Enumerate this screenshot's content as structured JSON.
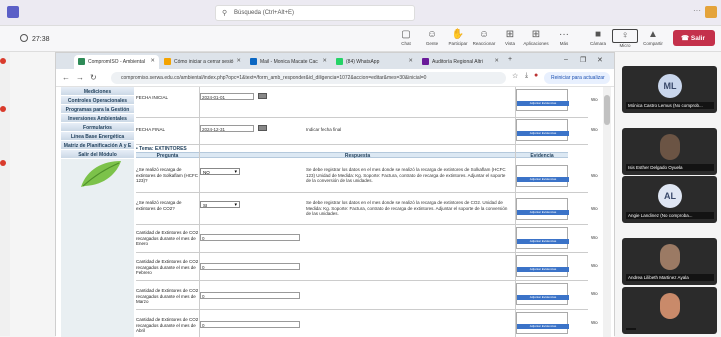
{
  "teams": {
    "search_placeholder": "Búsqueda (Ctrl+Alt+E)",
    "more": "···",
    "timer": "27:38",
    "toolbar": [
      {
        "label": "Chat",
        "icon": "chat-icon"
      },
      {
        "label": "Gente",
        "icon": "people-icon"
      },
      {
        "label": "Participar",
        "icon": "raise-hand-icon"
      },
      {
        "label": "Reaccionar",
        "icon": "react-icon"
      },
      {
        "label": "Vista",
        "icon": "view-icon"
      },
      {
        "label": "Aplicaciones",
        "icon": "apps-icon"
      },
      {
        "label": "Más",
        "icon": "more-icon"
      },
      {
        "label": "Cámara",
        "icon": "camera-icon"
      },
      {
        "label": "Micro",
        "icon": "mic-icon"
      },
      {
        "label": "Compartir",
        "icon": "share-icon"
      }
    ],
    "leave_label": "Salir"
  },
  "browser": {
    "tabs": [
      {
        "label": "CompromISO - Ambiental",
        "color": "#2e8b57"
      },
      {
        "label": "Cómo iniciar a cerrar sesió",
        "color": "#f4a300"
      },
      {
        "label": "Mail - Monica Macate Cac",
        "color": "#0a66c2"
      },
      {
        "label": "(84) WhatsApp",
        "color": "#25d366"
      },
      {
        "label": "Auditoría Regional Altri",
        "color": "#6a1b9a"
      }
    ],
    "url": "compromiso.serwa.edu.co/ambiental/index.php?opc=1&text=/form_amb_responder&id_diligencia=1072&accion=editar&mes=30&inicial=0",
    "reinit_label": "Reiniciar para actualizar"
  },
  "sidemenu": [
    "Mediciones",
    "Controles Operacionales",
    "Programas para la Gestión",
    "Inversiones Ambientales",
    "Formularios",
    "Línea Base Energética",
    "Matriz de Planificación A y E",
    "Salir del Módulo"
  ],
  "form": {
    "fecha_inicial_label": "FECHA INICIAL",
    "fecha_inicial_value": "2024-01-01",
    "fecha_final_label": "FECHA FINAL",
    "fecha_final_value": "2024-12-31",
    "fecha_final_note": "Indicar fecha final",
    "upload_label": "Adjuntar Evidencias",
    "section": "• Tema: EXTINTORES",
    "headers": {
      "pregunta": "Pregunta",
      "respuesta": "Respuesta",
      "evidencia": "Evidencia"
    },
    "rows": [
      {
        "q": "¿Se realizó recarga de extintores de Solkaflam (HCFC 123)?",
        "ans": "NO",
        "text": "Se debe registrar los datos en el mes donde se realizó la recarga de extintores de Solkaflam (HCFC 123) Unidad de Medida: Kg. Soporte: Factura, contrato de recarga de extintores. Adjuntar el soporte de la conversión de las unidades."
      },
      {
        "q": "¿Se realizó recarga de extintores de CO2?",
        "ans": "SI",
        "text": "Se debe registrar los datos en el mes donde se realizó la recarga de extintores de CO2. Unidad de Medida: Kg. Soporte: Factura, contrato de recarga de extintores. Adjuntar el soporte de la conversión de las unidades."
      },
      {
        "q": "Cantidad de Extintores de CO2 recargados durante el mes de Enero",
        "ans": "0",
        "text": ""
      },
      {
        "q": "Cantidad de Extintores de CO2 recargados durante el mes de Febrero",
        "ans": "0",
        "text": ""
      },
      {
        "q": "Cantidad de Extintores de CO2 recargados durante el mes de Marzo",
        "ans": "0",
        "text": ""
      },
      {
        "q": "Cantidad de Extintores de CO2 recargados durante el mes de Abril",
        "ans": "0",
        "text": ""
      }
    ],
    "side_col_text": "Wo"
  },
  "participants": [
    {
      "initials": "ML",
      "name": "Mónica Castro Lemus (No comprob...",
      "kind": "avatar"
    },
    {
      "initials": "",
      "name": "Isis Esther Delgado Oyuela",
      "kind": "photo"
    },
    {
      "initials": "AL",
      "name": "Angie Landinez (No comproba...",
      "kind": "avatar"
    },
    {
      "initials": "",
      "name": "Andrea Lilibeth Martinez Ayala",
      "kind": "photo"
    },
    {
      "initials": "",
      "name": "",
      "kind": "photo"
    }
  ]
}
